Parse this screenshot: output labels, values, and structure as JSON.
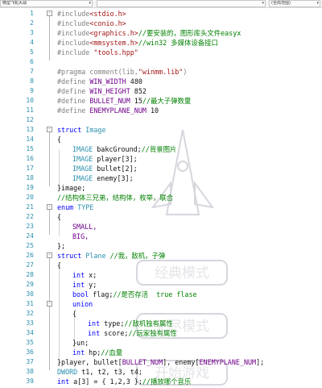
{
  "toolbar": {
    "left_dropdown": "微型飞机大战",
    "mid_dropdown": "",
    "right_dropdown": "(全局范围)"
  },
  "watermark": {
    "items": [
      "经典模式",
      "无尽模式",
      "开始游戏"
    ]
  },
  "colors": {
    "keyword": "#0000ff",
    "preprocessor": "#808080",
    "string": "#a31515",
    "comment": "#008000",
    "macro": "#6f008a",
    "type": "#2b91af",
    "line_number": "#2b91af"
  },
  "editor": {
    "lines": [
      {
        "num": "1",
        "fold": "-",
        "indent": 0,
        "tokens": [
          {
            "t": "#include",
            "c": "pp"
          },
          {
            "t": "<stdio.h>",
            "c": "str"
          }
        ]
      },
      {
        "num": "2",
        "fold": "",
        "indent": 0,
        "tokens": [
          {
            "t": "#include",
            "c": "pp"
          },
          {
            "t": "<conio.h>",
            "c": "str"
          }
        ]
      },
      {
        "num": "3",
        "fold": "",
        "indent": 0,
        "tokens": [
          {
            "t": "#include",
            "c": "pp"
          },
          {
            "t": "<graphics.h>",
            "c": "str"
          },
          {
            "t": "//要安装的，图形库头文件easyx",
            "c": "cm"
          }
        ]
      },
      {
        "num": "4",
        "fold": "",
        "indent": 0,
        "tokens": [
          {
            "t": "#include",
            "c": "pp"
          },
          {
            "t": "<mmsystem.h>",
            "c": "str"
          },
          {
            "t": "//win32 多媒体设备接口",
            "c": "cm"
          }
        ]
      },
      {
        "num": "5",
        "fold": "",
        "indent": 0,
        "tokens": [
          {
            "t": "#include ",
            "c": "pp"
          },
          {
            "t": "\"tools.hpp\"",
            "c": "str"
          }
        ]
      },
      {
        "num": "6",
        "fold": "",
        "indent": 0,
        "tokens": []
      },
      {
        "num": "7",
        "fold": "",
        "indent": 0,
        "tokens": [
          {
            "t": "#pragma ",
            "c": "pp"
          },
          {
            "t": "comment(lib,",
            "c": "pp"
          },
          {
            "t": "\"winmm.lib\"",
            "c": "str"
          },
          {
            "t": ")",
            "c": "pp"
          }
        ]
      },
      {
        "num": "8",
        "fold": "",
        "indent": 0,
        "tokens": [
          {
            "t": "#define ",
            "c": "pp"
          },
          {
            "t": "WIN_WIDTH",
            "c": "mac"
          },
          {
            "t": " 480",
            "c": ""
          }
        ]
      },
      {
        "num": "9",
        "fold": "",
        "indent": 0,
        "tokens": [
          {
            "t": "#define ",
            "c": "pp"
          },
          {
            "t": "WIN_HEIGHT",
            "c": "mac"
          },
          {
            "t": " 852",
            "c": ""
          }
        ]
      },
      {
        "num": "10",
        "fold": "",
        "indent": 0,
        "tokens": [
          {
            "t": "#define ",
            "c": "pp"
          },
          {
            "t": "BULLET_NUM",
            "c": "mac"
          },
          {
            "t": " 15",
            "c": ""
          },
          {
            "t": "//最大子弹数量",
            "c": "cm"
          }
        ]
      },
      {
        "num": "11",
        "fold": "",
        "indent": 0,
        "tokens": [
          {
            "t": "#define ",
            "c": "pp"
          },
          {
            "t": "ENEMYPLANE_NUM",
            "c": "mac"
          },
          {
            "t": " 10",
            "c": ""
          }
        ]
      },
      {
        "num": "12",
        "fold": "",
        "indent": 0,
        "tokens": []
      },
      {
        "num": "13",
        "fold": "-",
        "indent": 0,
        "tokens": [
          {
            "t": "struct ",
            "c": "kw"
          },
          {
            "t": "Image",
            "c": "ty"
          }
        ]
      },
      {
        "num": "14",
        "fold": "",
        "indent": 0,
        "tokens": [
          {
            "t": "{",
            "c": ""
          }
        ]
      },
      {
        "num": "15",
        "fold": "",
        "indent": 2,
        "tokens": [
          {
            "t": "IMAGE ",
            "c": "ty"
          },
          {
            "t": "bakcGround;",
            "c": ""
          },
          {
            "t": "//背景图片",
            "c": "cm"
          }
        ]
      },
      {
        "num": "16",
        "fold": "",
        "indent": 2,
        "tokens": [
          {
            "t": "IMAGE ",
            "c": "ty"
          },
          {
            "t": "player[3];",
            "c": ""
          }
        ]
      },
      {
        "num": "17",
        "fold": "",
        "indent": 2,
        "tokens": [
          {
            "t": "IMAGE ",
            "c": "ty"
          },
          {
            "t": "bullet[2];",
            "c": ""
          }
        ]
      },
      {
        "num": "18",
        "fold": "",
        "indent": 2,
        "tokens": [
          {
            "t": "IMAGE ",
            "c": "ty"
          },
          {
            "t": "enemy[3];",
            "c": ""
          }
        ]
      },
      {
        "num": "19",
        "fold": "",
        "indent": 0,
        "tokens": [
          {
            "t": "}image;",
            "c": ""
          }
        ]
      },
      {
        "num": "20",
        "fold": "",
        "indent": 0,
        "tokens": [
          {
            "t": "//结构体三兄弟，结构体，枚举，联合",
            "c": "cm"
          }
        ]
      },
      {
        "num": "21",
        "fold": "-",
        "indent": 0,
        "tokens": [
          {
            "t": "enum ",
            "c": "kw"
          },
          {
            "t": "TYPE",
            "c": "ty"
          }
        ]
      },
      {
        "num": "22",
        "fold": "",
        "indent": 0,
        "tokens": [
          {
            "t": "{",
            "c": ""
          }
        ]
      },
      {
        "num": "23",
        "fold": "",
        "indent": 2,
        "tokens": [
          {
            "t": "SMALL,",
            "c": "mac"
          }
        ]
      },
      {
        "num": "24",
        "fold": "",
        "indent": 2,
        "tokens": [
          {
            "t": "BIG,",
            "c": "mac"
          }
        ]
      },
      {
        "num": "25",
        "fold": "",
        "indent": 0,
        "tokens": [
          {
            "t": "};",
            "c": ""
          }
        ]
      },
      {
        "num": "26",
        "fold": "-",
        "indent": 0,
        "tokens": [
          {
            "t": "struct ",
            "c": "kw"
          },
          {
            "t": "Plane ",
            "c": "ty"
          },
          {
            "t": "//我，敌机，子弹",
            "c": "cm"
          }
        ]
      },
      {
        "num": "27",
        "fold": "",
        "indent": 0,
        "tokens": [
          {
            "t": "{",
            "c": ""
          }
        ]
      },
      {
        "num": "28",
        "fold": "",
        "indent": 2,
        "tokens": [
          {
            "t": "int ",
            "c": "kw"
          },
          {
            "t": "x;",
            "c": ""
          }
        ]
      },
      {
        "num": "29",
        "fold": "",
        "indent": 2,
        "tokens": [
          {
            "t": "int ",
            "c": "kw"
          },
          {
            "t": "y;",
            "c": ""
          }
        ]
      },
      {
        "num": "30",
        "fold": "",
        "indent": 2,
        "tokens": [
          {
            "t": "bool ",
            "c": "kw"
          },
          {
            "t": "flag;",
            "c": ""
          },
          {
            "t": "//是否存活  true flase",
            "c": "cm"
          }
        ]
      },
      {
        "num": "31",
        "fold": "-",
        "indent": 2,
        "tokens": [
          {
            "t": "union",
            "c": "kw"
          }
        ]
      },
      {
        "num": "32",
        "fold": "",
        "indent": 2,
        "tokens": [
          {
            "t": "{",
            "c": ""
          }
        ]
      },
      {
        "num": "33",
        "fold": "",
        "indent": 4,
        "tokens": [
          {
            "t": "int ",
            "c": "kw"
          },
          {
            "t": "type;",
            "c": ""
          },
          {
            "t": "//敌机独有属性",
            "c": "cm"
          }
        ]
      },
      {
        "num": "34",
        "fold": "",
        "indent": 4,
        "tokens": [
          {
            "t": "int ",
            "c": "kw"
          },
          {
            "t": "score;",
            "c": ""
          },
          {
            "t": "//玩家独有属性",
            "c": "cm"
          }
        ]
      },
      {
        "num": "35",
        "fold": "",
        "indent": 2,
        "tokens": [
          {
            "t": "}un;",
            "c": ""
          }
        ]
      },
      {
        "num": "36",
        "fold": "",
        "indent": 2,
        "tokens": [
          {
            "t": "int ",
            "c": "kw"
          },
          {
            "t": "hp;",
            "c": ""
          },
          {
            "t": "//血量",
            "c": "cm"
          }
        ]
      },
      {
        "num": "37",
        "fold": "",
        "indent": 0,
        "tokens": [
          {
            "t": "}player, bullet[",
            "c": ""
          },
          {
            "t": "BULLET_NUM",
            "c": "mac"
          },
          {
            "t": "], enemy[",
            "c": ""
          },
          {
            "t": "ENEMYPLANE_NUM",
            "c": "mac"
          },
          {
            "t": "];",
            "c": ""
          }
        ]
      },
      {
        "num": "38",
        "fold": "",
        "indent": 0,
        "tokens": [
          {
            "t": "DWORD ",
            "c": "ty"
          },
          {
            "t": "t1, t2, t3, t4;",
            "c": ""
          }
        ]
      },
      {
        "num": "39",
        "fold": "",
        "indent": 0,
        "tokens": [
          {
            "t": "int ",
            "c": "kw"
          },
          {
            "t": "a[3] = { 1,2,3 };",
            "c": ""
          },
          {
            "t": "//播放哪个音乐",
            "c": "cm"
          }
        ]
      },
      {
        "num": "40",
        "fold": "",
        "indent": 0,
        "tokens": [
          {
            "t": "DWORD ",
            "c": "ty"
          },
          {
            "t": "WINAPI ",
            "c": "mac"
          },
          {
            "t": "PlayGun(LPVOID lparanter);",
            "c": ""
          }
        ]
      },
      {
        "num": "41",
        "fold": "",
        "indent": 0,
        "tokens": [
          {
            "t": "//处理键盘，实时响应，实时的子弹发",
            "c": "cm"
          }
        ]
      }
    ]
  }
}
